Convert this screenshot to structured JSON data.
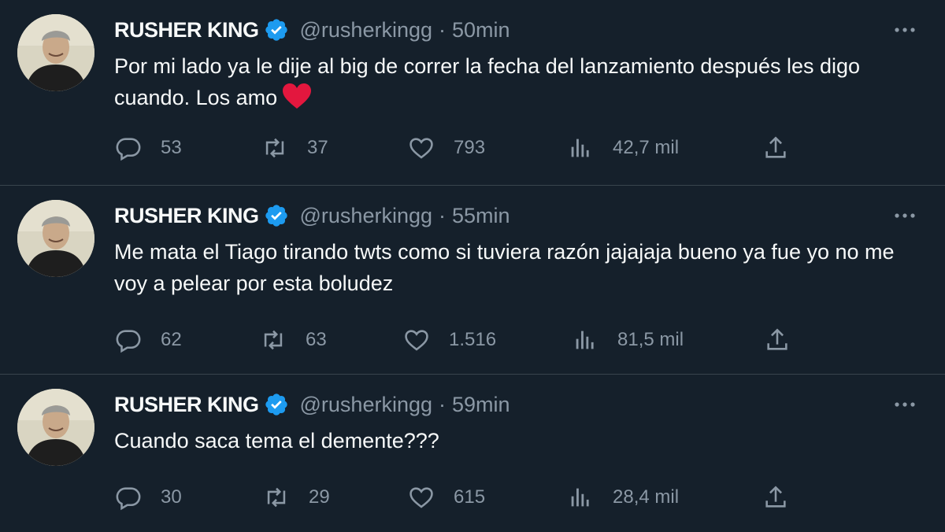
{
  "colors": {
    "background": "#15202b",
    "divider": "#38444d",
    "text_primary": "#f7f9f9",
    "text_secondary": "#8b98a5",
    "verified": "#1d9bf0",
    "heart": "#f91880"
  },
  "tweets": [
    {
      "name": "RUSHER KING",
      "handle": "@rusherkingg",
      "separator": "·",
      "time": "50min",
      "text": "Por mi lado ya le dije al big de correr la fecha del lanzamiento después les digo cuando. Los amo",
      "emoji": "red-heart-icon",
      "replies": "53",
      "retweets": "37",
      "likes": "793",
      "views": "42,7 mil"
    },
    {
      "name": "RUSHER KING",
      "handle": "@rusherkingg",
      "separator": "·",
      "time": "55min",
      "text": "Me mata el Tiago tirando twts como si tuviera razón jajajaja bueno ya fue yo no me voy a pelear por esta boludez",
      "replies": "62",
      "retweets": "63",
      "likes": "1.516",
      "views": "81,5 mil"
    },
    {
      "name": "RUSHER KING",
      "handle": "@rusherkingg",
      "separator": "·",
      "time": "59min",
      "text": "Cuando saca tema el demente???",
      "replies": "30",
      "retweets": "29",
      "likes": "615",
      "views": "28,4 mil"
    }
  ]
}
